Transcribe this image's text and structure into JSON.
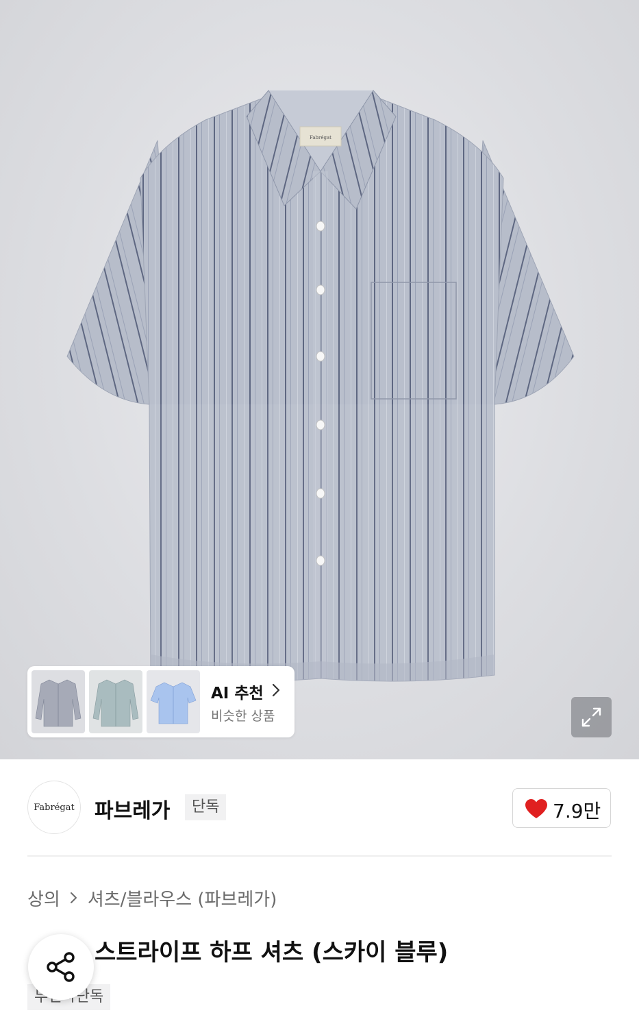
{
  "hero": {
    "image_alt": "파브레가 스트라이프 하프 셔츠 (스카이 블루)",
    "shirt_label": "Fabrégat"
  },
  "ai_recommend": {
    "title": "AI 추천",
    "subtitle": "비슷한 상품",
    "thumbnails": [
      "long-sleeve-stripe-shirt",
      "long-sleeve-mint-shirt",
      "short-sleeve-blue-shirt"
    ]
  },
  "expand": {
    "icon": "expand-icon"
  },
  "brand": {
    "logo_text": "Fabrégat",
    "name": "파브레가",
    "badge": "단독"
  },
  "like": {
    "count": "7.9만",
    "icon": "heart-icon",
    "color": "#e02020"
  },
  "breadcrumb": {
    "items": [
      "상의",
      "셔츠/블라우스 (파브레가)"
    ]
  },
  "product": {
    "title": "스트라이프 하프 셔츠 (스카이 블루)",
    "tag": "무신사단독"
  },
  "share": {
    "icon": "share-icon"
  }
}
